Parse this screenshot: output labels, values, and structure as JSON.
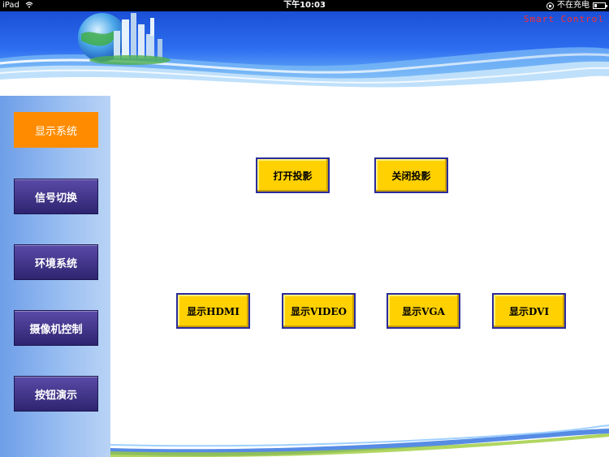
{
  "status_bar": {
    "device": "iPad",
    "time": "下午10:03",
    "charging": "不在充电"
  },
  "header": {
    "brand": "Smart Control"
  },
  "sidebar": {
    "items": [
      {
        "label": "显示系统",
        "active": true
      },
      {
        "label": "信号切换",
        "active": false
      },
      {
        "label": "环境系统",
        "active": false
      },
      {
        "label": "摄像机控制",
        "active": false
      },
      {
        "label": "按钮演示",
        "active": false
      }
    ]
  },
  "main": {
    "projector_buttons": [
      "打开投影",
      "关闭投影"
    ],
    "display_buttons": [
      "显示HDMI",
      "显示VIDEO",
      "显示VGA",
      "显示DVI"
    ]
  },
  "colors": {
    "accent_active": "#ff8c00",
    "button_yellow": "#ffd100",
    "nav_purple": "#3a2f86",
    "header_blue": "#1a4fd6",
    "brand_red": "#ff2b2b"
  }
}
